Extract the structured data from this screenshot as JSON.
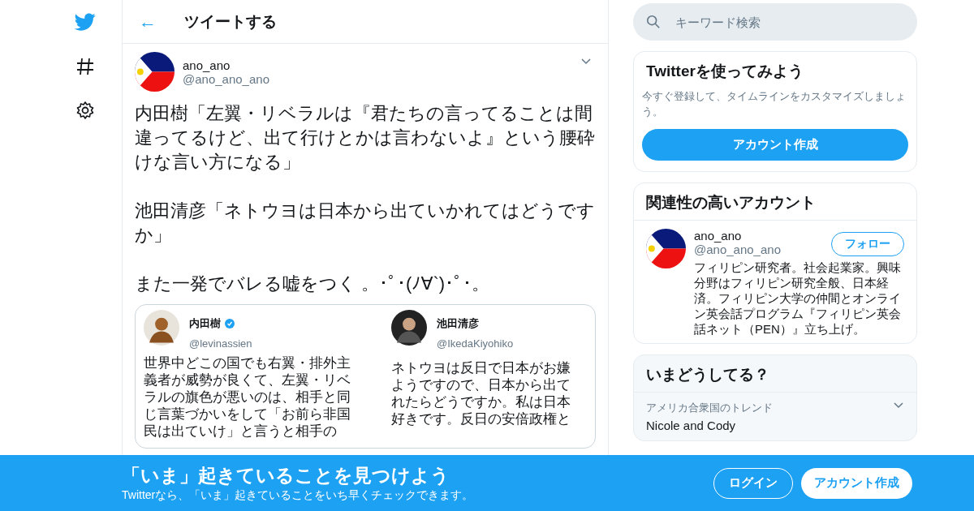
{
  "nav": [
    {
      "kind": "bird"
    },
    {
      "kind": "hash"
    },
    {
      "kind": "gear"
    }
  ],
  "header": {
    "back": "←",
    "title": "ツイートする"
  },
  "tweet": {
    "name": "ano_ano",
    "handle": "@ano_ano_ano",
    "paragraphs": [
      "内田樹「左翼・リベラルは『君たちの言ってることは間違ってるけど、出て行けとかは言わないよ』という腰砕けな言い方になる」",
      "池田清彦「ネトウヨは日本から出ていかれてはどうですか」",
      "また一発でバレる嘘をつく 。･ﾟ･(ﾉ∀`)･ﾟ･。"
    ],
    "image": {
      "cards": [
        {
          "name": "内田樹",
          "verified": true,
          "handle": "@levinassien",
          "lines": [
            "世界中どこの国でも右翼・排外主",
            "義者が威勢が良くて、左翼・リベ",
            "ラルの旗色が悪いのは、相手と同",
            "じ言葉づかいをして「お前ら非国",
            "民は出ていけ」と言うと相手の"
          ]
        },
        {
          "name": "池田清彦",
          "verified": false,
          "handle": "@IkedaKiyohiko",
          "lines": [
            "ネトウヨは反日で日本がお嫌",
            "ようですので、日本から出て",
            "れたらどうですか。私は日本",
            "好きです。反日の安倍政権と"
          ]
        }
      ]
    }
  },
  "search": {
    "placeholder": "キーワード検索"
  },
  "signup": {
    "title": "Twitterを使ってみよう",
    "text": "今すぐ登録して、タイムラインをカスタマイズしましょう。",
    "button": "アカウント作成"
  },
  "related": {
    "title": "関連性の高いアカウント",
    "name": "ano_ano",
    "handle": "@ano_ano_ano",
    "follow": "フォロー",
    "bio": "フィリピン研究者。社会起業家。興味分野はフィリピン研究全般、日本経済。フィリピン大学の仲間とオンライン英会話プログラム『フィリピン英会話ネット（PEN）』立ち上げ。"
  },
  "trends": {
    "title": "いまどうしてる？",
    "items": [
      {
        "context": "アメリカ合衆国のトレンド",
        "name": "Nicole and Cody"
      }
    ]
  },
  "banner": {
    "title": "「いま」起きていることを見つけよう",
    "text": "Twitterなら、「いま」起きていることをいち早くチェックできます。",
    "login": "ログイン",
    "signup": "アカウント作成"
  }
}
